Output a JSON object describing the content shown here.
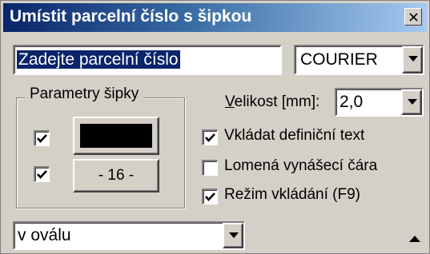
{
  "window": {
    "title": "Umístit parcelní číslo s šipkou"
  },
  "parcel_input": {
    "value": "Zadejte parcelní číslo"
  },
  "font_select": {
    "value": "COURIER"
  },
  "arrow_group": {
    "legend": "Parametry šipky",
    "color_checked": true,
    "color_value": "#000000",
    "number_checked": true,
    "number_button_label": "- 16 -"
  },
  "size": {
    "label_accel": "V",
    "label_rest": "elikost [mm]:",
    "value": "2,0"
  },
  "options": [
    {
      "label": "Vkládat definiční text",
      "checked": true
    },
    {
      "label": "Lomená vynášecí čára",
      "checked": false
    },
    {
      "label": "Režim vkládání (F9)",
      "checked": true
    }
  ],
  "placement_select": {
    "value": "v oválu"
  },
  "icons": {
    "close": "close-icon",
    "dropdown": "triangle-down-icon",
    "collapse": "triangle-up-icon",
    "check": "check-icon"
  }
}
